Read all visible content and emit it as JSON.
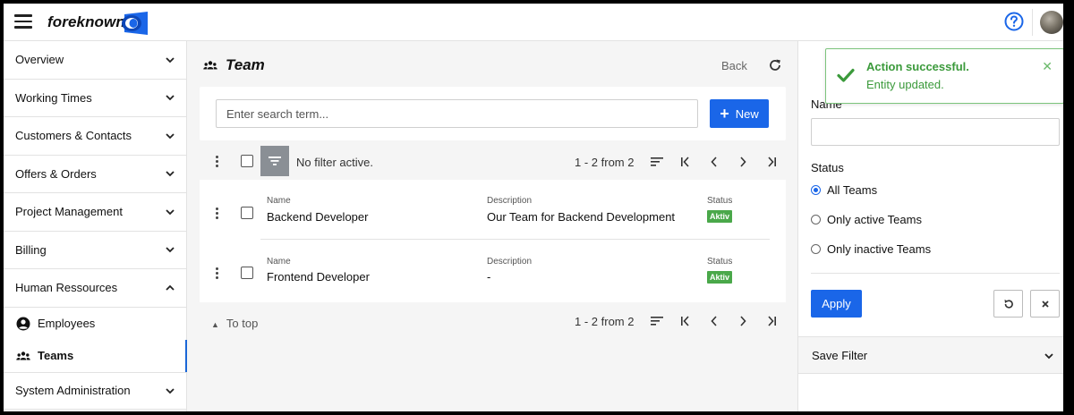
{
  "app": {
    "brand": "foreknown"
  },
  "sidebar": {
    "items": [
      {
        "label": "Overview"
      },
      {
        "label": "Working Times"
      },
      {
        "label": "Customers & Contacts"
      },
      {
        "label": "Offers & Orders"
      },
      {
        "label": "Project Management"
      },
      {
        "label": "Billing"
      },
      {
        "label": "Human Ressources"
      }
    ],
    "sub_items": [
      {
        "label": "Employees",
        "icon": "person-circle-icon"
      },
      {
        "label": "Teams",
        "icon": "group-icon",
        "active": true
      }
    ],
    "bottom_item": {
      "label": "System Administration"
    }
  },
  "main": {
    "title": "Team",
    "back": "Back",
    "search": {
      "placeholder": "Enter search term...",
      "value": ""
    },
    "new_button": "New",
    "filter_status": "No filter active.",
    "pager": "1 - 2 from 2",
    "columns": {
      "name": "Name",
      "description": "Description",
      "status": "Status"
    },
    "rows": [
      {
        "name": "Backend Developer",
        "description": "Our Team for Backend Development",
        "status": "Aktiv"
      },
      {
        "name": "Frontend Developer",
        "description": "-",
        "status": "Aktiv"
      }
    ],
    "to_top": "To top"
  },
  "filter_panel": {
    "name_label": "Name",
    "name_value": "",
    "status_label": "Status",
    "options": [
      {
        "label": "All Teams",
        "selected": true
      },
      {
        "label": "Only active Teams",
        "selected": false
      },
      {
        "label": "Only inactive Teams",
        "selected": false
      }
    ],
    "apply": "Apply",
    "save_filter": "Save Filter"
  },
  "toast": {
    "title": "Action successful.",
    "message": "Entity updated."
  },
  "colors": {
    "accent": "#1a66e8",
    "success": "#3b9a3b",
    "badge": "#4aa84a"
  }
}
